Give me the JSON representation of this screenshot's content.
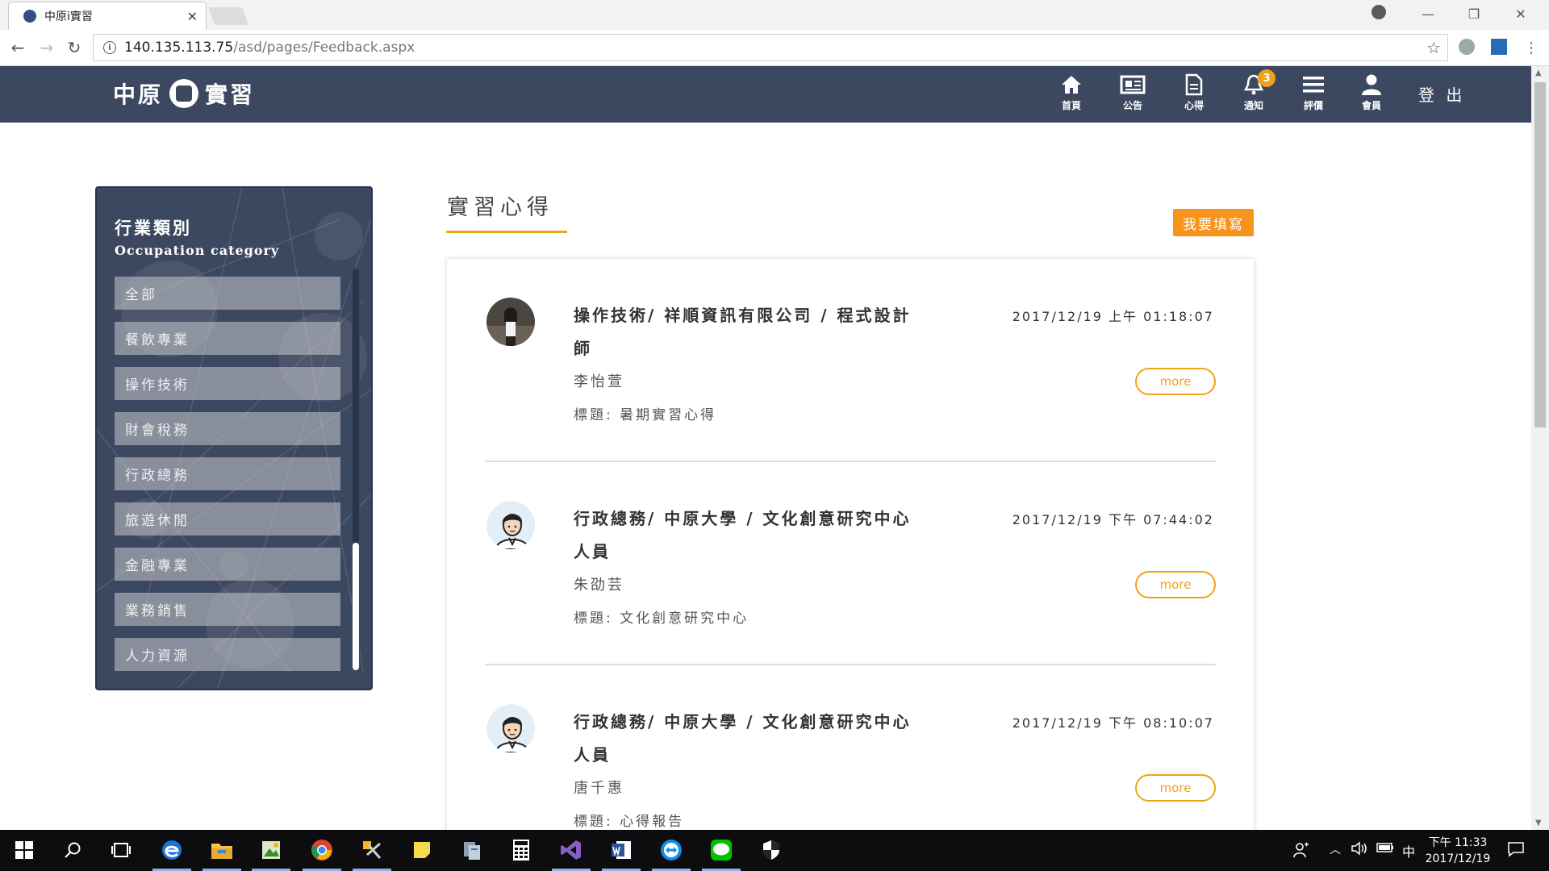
{
  "browser": {
    "tab_title": "中原i實習",
    "url_host": "140.135.113.75",
    "url_path": "/asd/pages/Feedback.aspx"
  },
  "header": {
    "logo_left": "中原",
    "logo_right": "實習",
    "nav": [
      {
        "label": "首頁",
        "icon": "home-icon"
      },
      {
        "label": "公告",
        "icon": "newspaper-icon"
      },
      {
        "label": "心得",
        "icon": "document-icon"
      },
      {
        "label": "通知",
        "icon": "bell-icon",
        "badge": "3"
      },
      {
        "label": "評價",
        "icon": "menu-icon"
      },
      {
        "label": "會員",
        "icon": "user-icon"
      }
    ],
    "logout": "登 出"
  },
  "sidebar": {
    "title": "行業類別",
    "subtitle": "Occupation category",
    "items": [
      "全部",
      "餐飲專業",
      "操作技術",
      "財會稅務",
      "行政總務",
      "旅遊休閒",
      "金融專業",
      "業務銷售",
      "人力資源"
    ]
  },
  "main": {
    "title": "實習心得",
    "write_button": "我要填寫",
    "more_label": "more",
    "entries": [
      {
        "heading": "操作技術/ 祥順資訊有限公司 / 程式設計師",
        "date": "2017/12/19 上午 01:18:07",
        "name": "李怡萱",
        "subject": "標題: 暑期實習心得"
      },
      {
        "heading": "行政總務/ 中原大學 / 文化創意研究中心人員",
        "date": "2017/12/19 下午 07:44:02",
        "name": "朱劭芸",
        "subject": "標題: 文化創意研究中心"
      },
      {
        "heading": "行政總務/ 中原大學 / 文化創意研究中心人員",
        "date": "2017/12/19 下午 08:10:07",
        "name": "唐千惠",
        "subject": "標題: 心得報告"
      }
    ]
  },
  "taskbar": {
    "ime": "中",
    "time": "下午 11:33",
    "date": "2017/12/19"
  },
  "colors": {
    "header_bg": "#3c4760",
    "accent": "#f0a31a",
    "write_button": "#f7941d"
  }
}
